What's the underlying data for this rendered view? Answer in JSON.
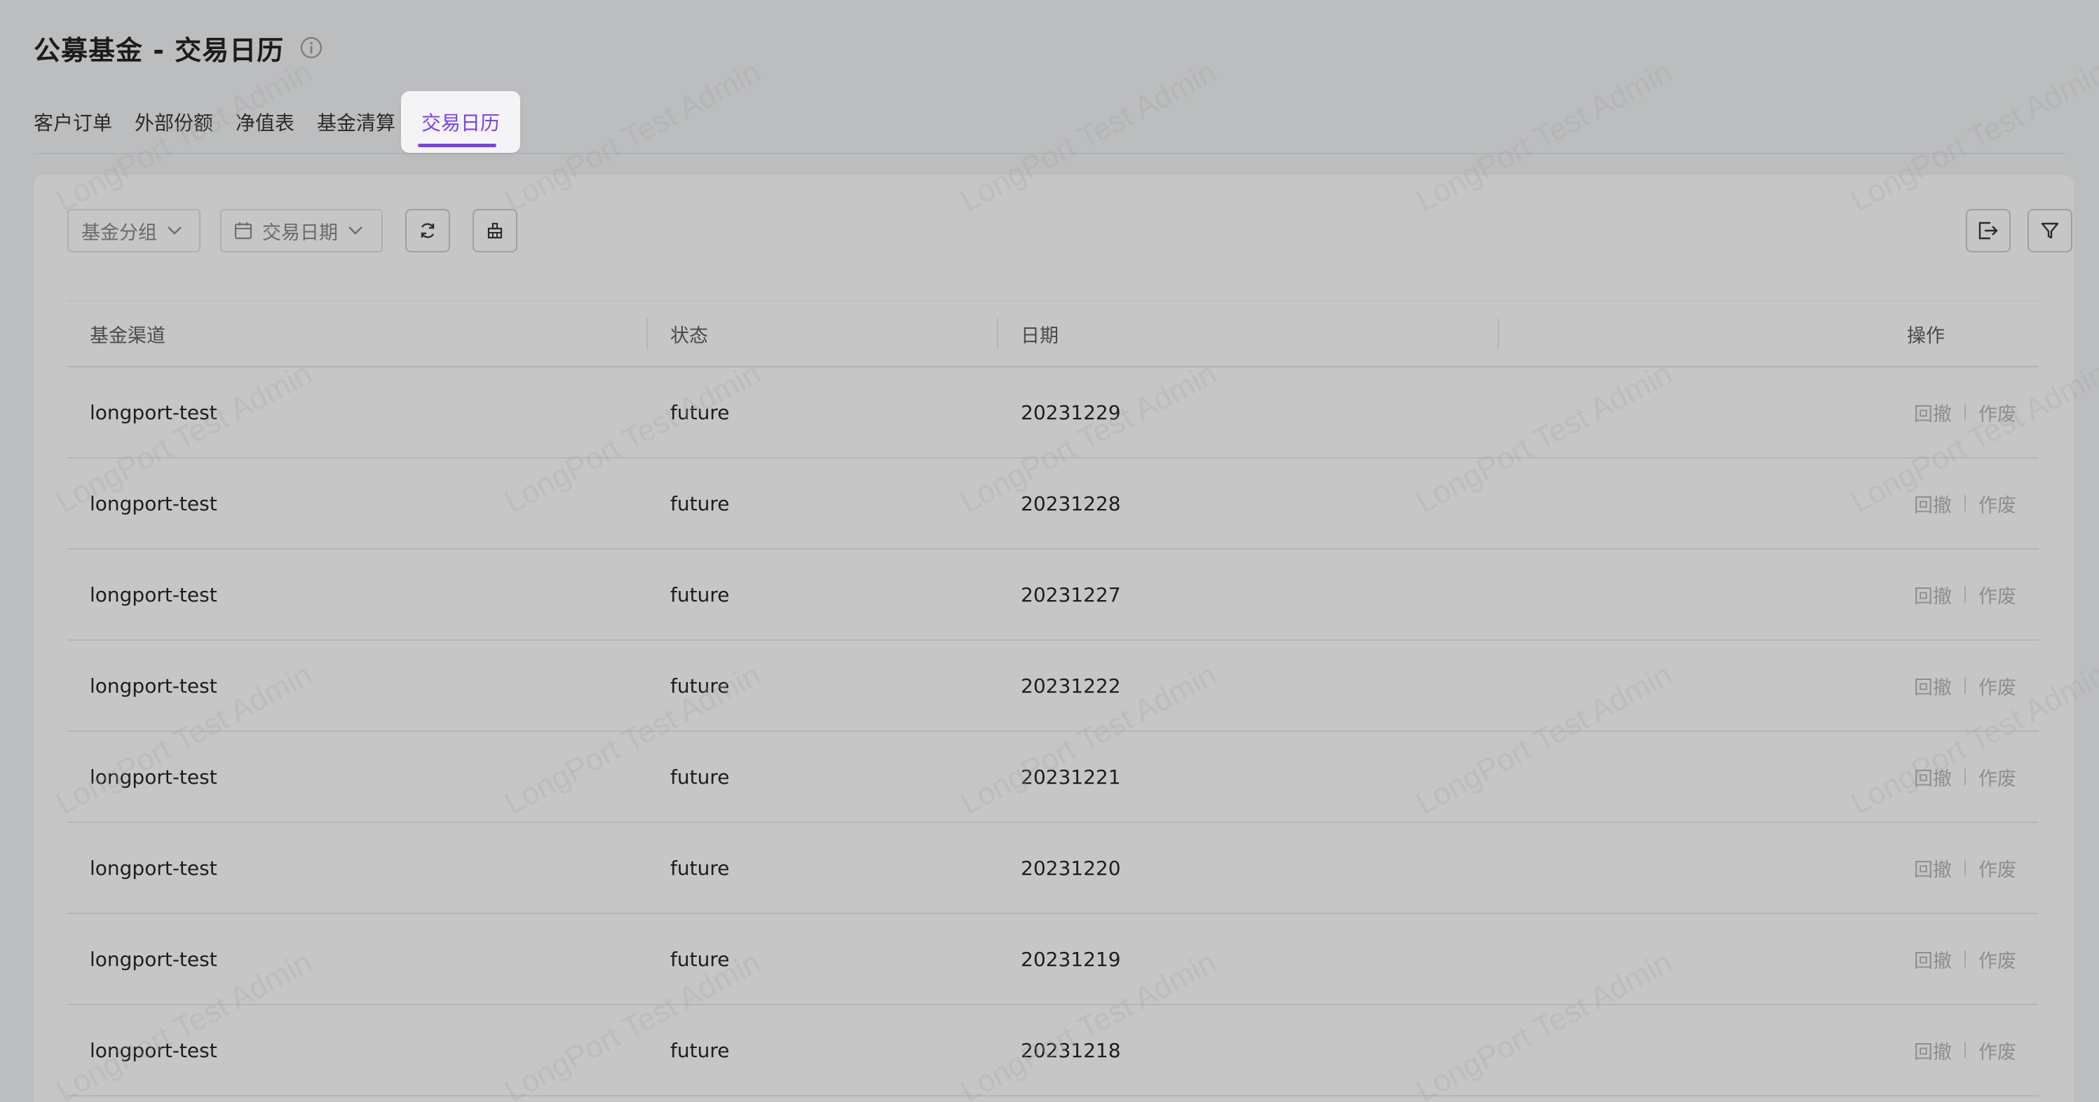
{
  "page_title": "公募基金 - 交易日历",
  "tabs": [
    {
      "label": "客户订单"
    },
    {
      "label": "外部份额"
    },
    {
      "label": "净值表"
    },
    {
      "label": "基金清算"
    },
    {
      "label": "交易日历",
      "active": true
    }
  ],
  "toolbar": {
    "fund_group_label": "基金分组",
    "trade_date_label": "交易日期"
  },
  "table": {
    "headers": {
      "channel": "基金渠道",
      "status": "状态",
      "date": "日期",
      "actions": "操作"
    },
    "rows": [
      {
        "channel": "longport-test",
        "status": "future",
        "date": "20231229",
        "action_revert": "回撤",
        "action_void": "作废"
      },
      {
        "channel": "longport-test",
        "status": "future",
        "date": "20231228",
        "action_revert": "回撤",
        "action_void": "作废"
      },
      {
        "channel": "longport-test",
        "status": "future",
        "date": "20231227",
        "action_revert": "回撤",
        "action_void": "作废"
      },
      {
        "channel": "longport-test",
        "status": "future",
        "date": "20231222",
        "action_revert": "回撤",
        "action_void": "作废"
      },
      {
        "channel": "longport-test",
        "status": "future",
        "date": "20231221",
        "action_revert": "回撤",
        "action_void": "作废"
      },
      {
        "channel": "longport-test",
        "status": "future",
        "date": "20231220",
        "action_revert": "回撤",
        "action_void": "作废"
      },
      {
        "channel": "longport-test",
        "status": "future",
        "date": "20231219",
        "action_revert": "回撤",
        "action_void": "作废"
      },
      {
        "channel": "longport-test",
        "status": "future",
        "date": "20231218",
        "action_revert": "回撤",
        "action_void": "作废"
      }
    ]
  },
  "watermark_text": "LongPort Test Admin",
  "colors": {
    "accent": "#7b3ff2",
    "background": "#bcbdbe",
    "panel": "#c6c6c7"
  },
  "icons": {
    "title_info": "info-circle-icon",
    "dropdown": "chevron-down-icon",
    "date": "calendar-icon",
    "refresh": "refresh-icon",
    "clear": "broom-icon",
    "export": "export-icon",
    "filter": "filter-icon"
  }
}
